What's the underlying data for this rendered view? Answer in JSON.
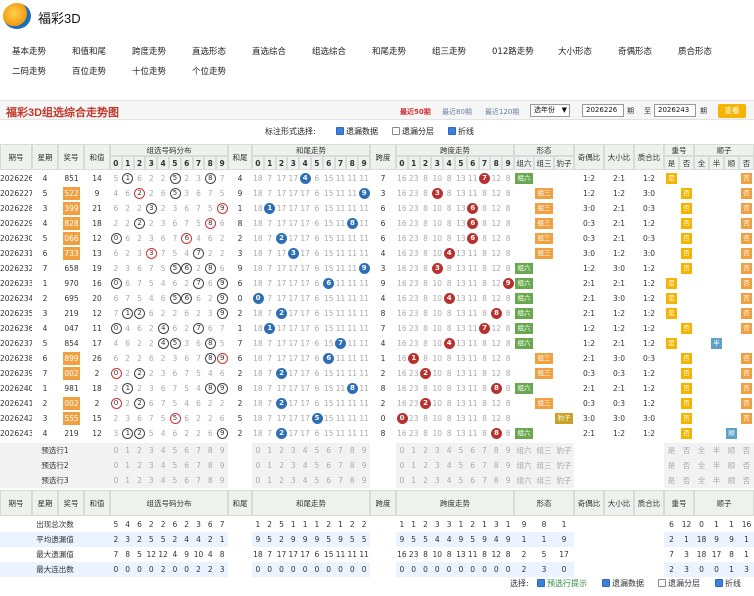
{
  "app": {
    "title": "福彩3D"
  },
  "nav": {
    "row1": [
      "基本走势",
      "和值和尾",
      "跨度走势",
      "直选形态",
      "直选综合",
      "组选综合",
      "和尾走势",
      "组三走势",
      "012路走势",
      "大小形态",
      "奇偶形态",
      "质合形态"
    ],
    "row2": [
      "二码走势",
      "百位走势",
      "十位走势",
      "个位走势"
    ]
  },
  "toolbar": {
    "chart_title": "福彩3D组选综合走势图",
    "recent50": "最近50期",
    "recent80": "最近80期",
    "recent120": "最近120期",
    "period_select": "选年份",
    "from_issue": "2026226",
    "to_label": "至",
    "to_issue": "2026243",
    "issue_suffix": "期",
    "query_label": "查看",
    "from_suffix": "期"
  },
  "options": {
    "label": "标注形式选择:",
    "o1": "遗漏数据",
    "o2": "遗漏分层",
    "o3": "折线"
  },
  "headers": {
    "issue": "期号",
    "week": "星期",
    "prize": "奖号",
    "sum": "和值",
    "dist": "组选号码分布",
    "tail": "和尾",
    "tailtrend": "和尾走势",
    "span": "跨度",
    "spantrend": "跨度走势",
    "shape": "形态",
    "shapeA": "组六",
    "shapeB": "组三",
    "shapeC": "豹子",
    "oe": "奇偶比",
    "bs": "大小比",
    "pc": "质合比",
    "rep": "重号",
    "repA": "是",
    "repB": "否",
    "order": "顺子",
    "orderA": "全",
    "orderB": "半",
    "orderC": "顺",
    "orderD": "否",
    "digits": [
      "0",
      "1",
      "2",
      "3",
      "4",
      "5",
      "6",
      "7",
      "8",
      "9"
    ]
  },
  "rows": [
    {
      "issue": "2026226",
      "week": "4",
      "prize": "851",
      "sum": "14",
      "tail": "4",
      "span": "7",
      "shape": "组六",
      "oe": "1:2",
      "bs": "2:1",
      "pc": "1:2",
      "rep": "是",
      "ord": "否"
    },
    {
      "issue": "2026227",
      "week": "5",
      "prize": "522",
      "sum": "9",
      "tail": "9",
      "span": "3",
      "shape": "组三",
      "oe": "1:2",
      "bs": "1:2",
      "pc": "3:0",
      "rep": "否",
      "ord": "否"
    },
    {
      "issue": "2026228",
      "week": "3",
      "prize": "399",
      "sum": "21",
      "tail": "1",
      "span": "6",
      "shape": "组三",
      "oe": "3:0",
      "bs": "2:1",
      "pc": "0:3",
      "rep": "否",
      "ord": "否"
    },
    {
      "issue": "2026229",
      "week": "4",
      "prize": "828",
      "sum": "18",
      "tail": "8",
      "span": "6",
      "shape": "组三",
      "oe": "0:3",
      "bs": "2:1",
      "pc": "1:2",
      "rep": "否",
      "ord": "否"
    },
    {
      "issue": "2026230",
      "week": "5",
      "prize": "066",
      "sum": "12",
      "tail": "2",
      "span": "6",
      "shape": "组三",
      "oe": "0:3",
      "bs": "2:1",
      "pc": "0:3",
      "rep": "否",
      "ord": "否"
    },
    {
      "issue": "2026231",
      "week": "6",
      "prize": "733",
      "sum": "13",
      "tail": "3",
      "span": "4",
      "shape": "组三",
      "oe": "3:0",
      "bs": "1:2",
      "pc": "3:0",
      "rep": "否",
      "ord": "否"
    },
    {
      "issue": "2026232",
      "week": "7",
      "prize": "658",
      "sum": "19",
      "tail": "9",
      "span": "3",
      "shape": "组六",
      "oe": "1:2",
      "bs": "3:0",
      "pc": "1:2",
      "rep": "否",
      "ord": "否"
    },
    {
      "issue": "2026233",
      "week": "1",
      "prize": "970",
      "sum": "16",
      "tail": "6",
      "span": "9",
      "shape": "组六",
      "oe": "2:1",
      "bs": "2:1",
      "pc": "1:2",
      "rep": "是",
      "ord": "否"
    },
    {
      "issue": "2026234",
      "week": "2",
      "prize": "695",
      "sum": "20",
      "tail": "0",
      "span": "4",
      "shape": "组六",
      "oe": "2:1",
      "bs": "3:0",
      "pc": "1:2",
      "rep": "是",
      "ord": "否"
    },
    {
      "issue": "2026235",
      "week": "3",
      "prize": "219",
      "pc": "1:2",
      "sum": "12",
      "tail": "2",
      "span": "8",
      "shape": "组六",
      "oe": "2:1",
      "bs": "1:2",
      "rep": "是",
      "ord": "否"
    },
    {
      "issue": "2026236",
      "week": "4",
      "prize": "047",
      "sum": "11",
      "tail": "1",
      "span": "7",
      "shape": "组六",
      "oe": "1:2",
      "bs": "1:2",
      "pc": "1:2",
      "rep": "否",
      "ord": "否"
    },
    {
      "issue": "2026237",
      "week": "5",
      "prize": "854",
      "sum": "17",
      "tail": "7",
      "span": "4",
      "shape": "组六",
      "oe": "1:2",
      "bs": "2:1",
      "pc": "1:2",
      "rep": "是",
      "ord": "半"
    },
    {
      "issue": "2026238",
      "week": "6",
      "prize": "899",
      "sum": "26",
      "tail": "6",
      "span": "1",
      "shape": "组三",
      "oe": "2:1",
      "bs": "3:0",
      "pc": "0:3",
      "rep": "否",
      "ord": "否"
    },
    {
      "issue": "2026239",
      "week": "7",
      "prize": "002",
      "sum": "2",
      "tail": "2",
      "span": "2",
      "shape": "组三",
      "oe": "0:3",
      "bs": "0:3",
      "pc": "1:2",
      "rep": "否",
      "ord": "否"
    },
    {
      "issue": "2026240",
      "week": "1",
      "prize": "981",
      "sum": "18",
      "tail": "8",
      "span": "8",
      "shape": "组六",
      "oe": "2:1",
      "bs": "2:1",
      "pc": "1:2",
      "rep": "否",
      "ord": "否"
    },
    {
      "issue": "2026241",
      "week": "2",
      "prize": "002",
      "sum": "2",
      "tail": "2",
      "span": "2",
      "shape": "组三",
      "oe": "0:3",
      "bs": "0:3",
      "pc": "1:2",
      "rep": "否",
      "ord": "否"
    },
    {
      "issue": "2026242",
      "week": "3",
      "prize": "555",
      "sum": "15",
      "tail": "5",
      "span": "0",
      "shape": "豹子",
      "oe": "3:0",
      "bs": "3:0",
      "pc": "3:0",
      "rep": "否",
      "ord": "否"
    },
    {
      "issue": "2026243",
      "week": "4",
      "prize": "219",
      "sum": "12",
      "tail": "2",
      "span": "8",
      "shape": "组六",
      "oe": "2:1",
      "bs": "1:2",
      "pc": "1:2",
      "rep": "否",
      "ord": "顺"
    }
  ],
  "preview": [
    "预选行1",
    "预选行2",
    "预选行3"
  ],
  "stats": [
    {
      "label": "出现总次数",
      "dist": [
        "5",
        "4",
        "6",
        "2",
        "2",
        "6",
        "2",
        "3",
        "6",
        "7"
      ],
      "tail": [
        "1",
        "2",
        "5",
        "1",
        "1",
        "1",
        "2",
        "1",
        "2",
        "2"
      ],
      "span": [
        "1",
        "1",
        "2",
        "3",
        "3",
        "1",
        "2",
        "1",
        "3",
        "1"
      ],
      "shape": [
        "9",
        "8",
        "1"
      ],
      "rep": [
        "6",
        "12"
      ],
      "ord": [
        "0",
        "1",
        "1",
        "16"
      ]
    },
    {
      "label": "平均遗漏值",
      "dist": [
        "2",
        "3",
        "2",
        "5",
        "5",
        "2",
        "4",
        "4",
        "2",
        "1"
      ],
      "tail": [
        "9",
        "5",
        "2",
        "9",
        "9",
        "9",
        "5",
        "9",
        "5",
        "5"
      ],
      "span": [
        "9",
        "5",
        "5",
        "4",
        "4",
        "9",
        "5",
        "9",
        "4",
        "9"
      ],
      "shape": [
        "1",
        "1",
        "9"
      ],
      "rep": [
        "2",
        "1"
      ],
      "ord": [
        "18",
        "9",
        "9",
        "1"
      ]
    },
    {
      "label": "最大遗漏值",
      "dist": [
        "7",
        "8",
        "5",
        "12",
        "12",
        "4",
        "9",
        "10",
        "4",
        "8"
      ],
      "tail": [
        "18",
        "7",
        "17",
        "17",
        "17",
        "6",
        "15",
        "11",
        "11",
        "11"
      ],
      "span": [
        "16",
        "23",
        "8",
        "10",
        "8",
        "13",
        "11",
        "8",
        "12",
        "8"
      ],
      "shape": [
        "2",
        "5",
        "17"
      ],
      "rep": [
        "7",
        "3"
      ],
      "ord": [
        "18",
        "17",
        "8",
        "1"
      ]
    },
    {
      "label": "最大连出数",
      "dist": [
        "0",
        "0",
        "0",
        "0",
        "2",
        "0",
        "0",
        "2",
        "2",
        "3"
      ],
      "tail": [
        "0",
        "0",
        "0",
        "0",
        "0",
        "0",
        "0",
        "0",
        "0",
        "0"
      ],
      "span": [
        "0",
        "0",
        "0",
        "0",
        "0",
        "0",
        "0",
        "0",
        "0",
        "0"
      ],
      "shape": [
        "2",
        "3",
        "0"
      ],
      "rep": [
        "2",
        "3"
      ],
      "ord": [
        "0",
        "0",
        "1",
        "3"
      ]
    }
  ],
  "footer": {
    "label": "选择:",
    "o1": "预选行提示",
    "o2": "遗漏数据",
    "o3": "遗漏分层",
    "o4": "折线"
  },
  "colors": {
    "blue": "#2d6eb5",
    "red": "#b8312f",
    "orange": "#f0a040",
    "green": "#6aa84f",
    "gold": "#f4b400"
  }
}
